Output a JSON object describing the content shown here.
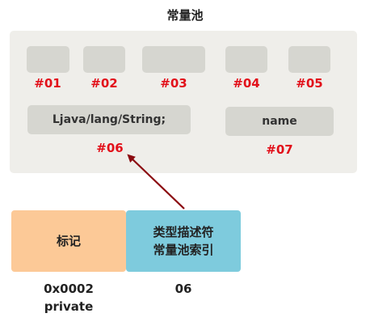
{
  "title": "常量池",
  "slots": [
    {
      "index": "#01",
      "text": ""
    },
    {
      "index": "#02",
      "text": ""
    },
    {
      "index": "#03",
      "text": ""
    },
    {
      "index": "#04",
      "text": ""
    },
    {
      "index": "#05",
      "text": ""
    },
    {
      "index": "#06",
      "text": "Ljava/lang/String;"
    },
    {
      "index": "#07",
      "text": "name"
    }
  ],
  "field": {
    "flag_label": "标记",
    "descriptor_label_line1": "类型描述符",
    "descriptor_label_line2": "常量池索引",
    "flag_value_line1": "0x0002",
    "flag_value_line2": "private",
    "descriptor_value": "06"
  },
  "colors": {
    "pool_bg": "#efeeea",
    "slot_bg": "#d6d6d0",
    "index_red": "#e2101a",
    "flag_box": "#fcc997",
    "descriptor_box": "#7ecbdd",
    "arrow": "#8b0a10"
  }
}
